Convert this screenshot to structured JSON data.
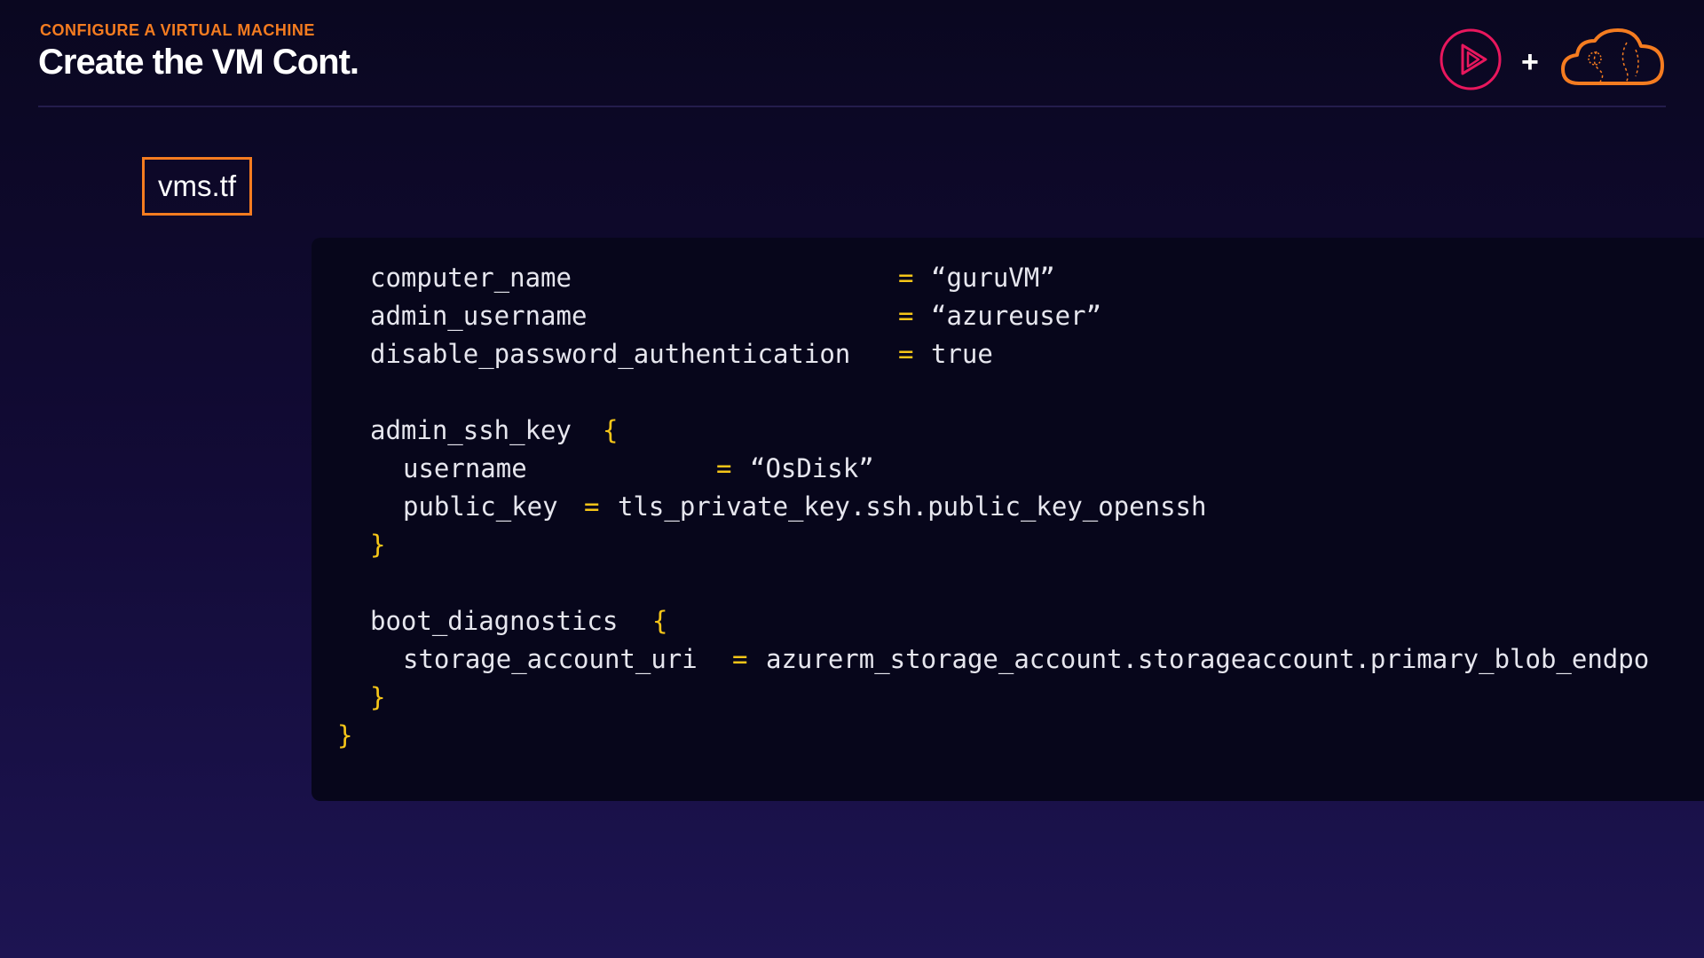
{
  "header": {
    "kicker": "CONFIGURE A VIRTUAL MACHINE",
    "title": "Create the VM Cont.",
    "plus": "+",
    "logos": [
      "play-logo-icon",
      "cloud-logo-icon"
    ]
  },
  "file_tab": {
    "label": "vms.tf"
  },
  "code": {
    "lines": [
      {
        "key": "computer_name",
        "op": "=",
        "value": "“guruVM”"
      },
      {
        "key": "admin_username",
        "op": "=",
        "value": "“azureuser”"
      },
      {
        "key": "disable_password_authentication",
        "op": "=",
        "value": "true"
      },
      {
        "key": "admin_ssh_key",
        "brace": "{"
      },
      {
        "key": "username",
        "op": "=",
        "value": "“OsDisk”"
      },
      {
        "key": "public_key",
        "op": "=",
        "value": "tls_private_key.ssh.public_key_openssh"
      },
      {
        "brace": "}"
      },
      {
        "key": "boot_diagnostics",
        "brace": "{"
      },
      {
        "key": "storage_account_uri",
        "op": "=",
        "value": "azurerm_storage_account.storageaccount.primary_blob_endpo"
      },
      {
        "brace": "}"
      },
      {
        "brace": "}"
      }
    ]
  },
  "colors": {
    "accent": "#f57c20",
    "operator": "#f5c518",
    "play_logo": "#e8175d",
    "background": "#120b36",
    "code_bg": "#07061b"
  }
}
